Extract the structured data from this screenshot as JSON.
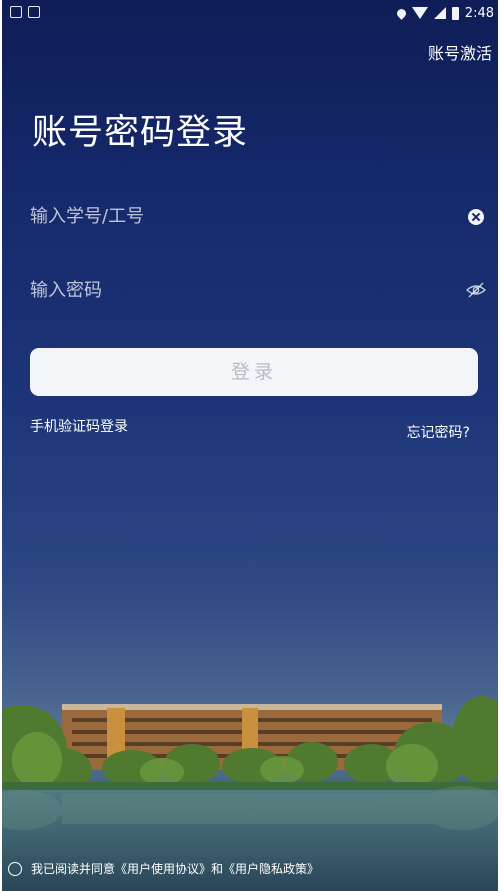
{
  "status_bar": {
    "time": "2:48"
  },
  "header": {
    "activate_label": "账号激活"
  },
  "title": "账号密码登录",
  "form": {
    "username_placeholder": "输入学号/工号",
    "password_placeholder": "输入密码",
    "login_label": "登录"
  },
  "links": {
    "sms_login": "手机验证码登录",
    "forgot_password": "忘记密码?"
  },
  "agreement": {
    "prefix": "我已阅读并同意",
    "user_agreement": "《用户使用协议》",
    "conjunction": "和",
    "privacy_policy": "《用户隐私政策》"
  },
  "icons": {
    "clear": "clear-icon",
    "password_visibility": "eye-slash-icon",
    "background": "campus-photo"
  }
}
